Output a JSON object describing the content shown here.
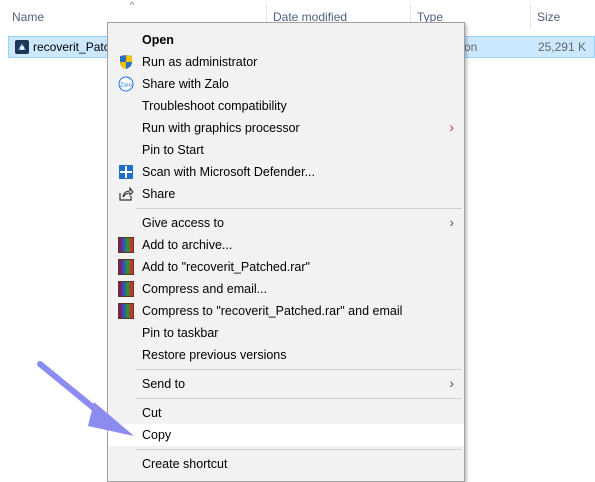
{
  "explorer": {
    "columns": {
      "name": "Name",
      "date_modified": "Date modified",
      "type": "Type",
      "size": "Size"
    },
    "file": {
      "name": "recoverit_Patc",
      "type_partial": "on",
      "size": "25,291 K"
    }
  },
  "context_menu": {
    "items": [
      {
        "label": "Open",
        "icon": "none",
        "bold": true
      },
      {
        "label": "Run as administrator",
        "icon": "uac-shield-icon"
      },
      {
        "label": "Share with Zalo",
        "icon": "zalo-icon"
      },
      {
        "label": "Troubleshoot compatibility",
        "icon": "none"
      },
      {
        "label": "Run with graphics processor",
        "icon": "none",
        "submenu": true
      },
      {
        "label": "Pin to Start",
        "icon": "none"
      },
      {
        "label": "Scan with Microsoft Defender...",
        "icon": "defender-icon"
      },
      {
        "label": "Share",
        "icon": "share-icon"
      },
      {
        "label": "Give access to",
        "icon": "none",
        "submenu": true
      },
      {
        "label": "Add to archive...",
        "icon": "winrar-icon"
      },
      {
        "label": "Add to \"recoverit_Patched.rar\"",
        "icon": "winrar-icon"
      },
      {
        "label": "Compress and email...",
        "icon": "winrar-icon"
      },
      {
        "label": "Compress to \"recoverit_Patched.rar\" and email",
        "icon": "winrar-icon"
      },
      {
        "label": "Pin to taskbar",
        "icon": "none"
      },
      {
        "label": "Restore previous versions",
        "icon": "none"
      },
      {
        "label": "Send to",
        "icon": "none",
        "submenu": true
      },
      {
        "label": "Cut",
        "icon": "none"
      },
      {
        "label": "Copy",
        "icon": "none",
        "highlighted": true
      },
      {
        "label": "Create shortcut",
        "icon": "none"
      }
    ],
    "chevron_glyph": "›"
  },
  "colors": {
    "selection_bg": "#cce8ff",
    "menu_bg": "#f2f2f2",
    "pointer_arrow": "#8c8cf0"
  }
}
